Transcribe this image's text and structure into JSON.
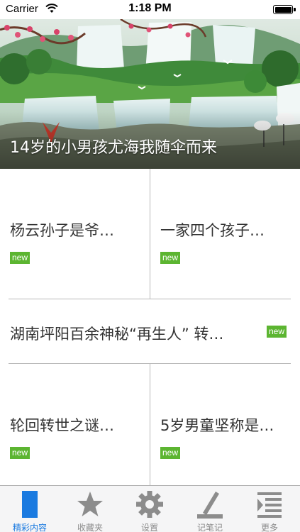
{
  "status_bar": {
    "carrier": "Carrier",
    "time": "1:18 PM"
  },
  "hero": {
    "caption": "14岁的小男孩尤海我随伞而来"
  },
  "news": [
    {
      "title": "杨云孙子是爷…",
      "badge": "new"
    },
    {
      "title": "一家四个孩子…",
      "badge": "new"
    },
    {
      "title": "湖南坪阳百余神秘“再生人” 转…",
      "badge": "new"
    },
    {
      "title": "轮回转世之谜…",
      "badge": "new"
    },
    {
      "title": "5岁男童坚称是…",
      "badge": "new"
    }
  ],
  "tab_bar": {
    "active_color": "#1a7ae0",
    "inactive_color": "#8c8c8c",
    "tabs": [
      {
        "label": "精彩内容",
        "icon": "document-icon",
        "active": true
      },
      {
        "label": "收藏夹",
        "icon": "star-icon",
        "active": false
      },
      {
        "label": "设置",
        "icon": "gear-icon",
        "active": false
      },
      {
        "label": "记笔记",
        "icon": "pen-icon",
        "active": false
      },
      {
        "label": "更多",
        "icon": "list-icon",
        "active": false
      }
    ]
  },
  "colors": {
    "badge": "#5cb531",
    "divider": "#b8b8b8"
  }
}
